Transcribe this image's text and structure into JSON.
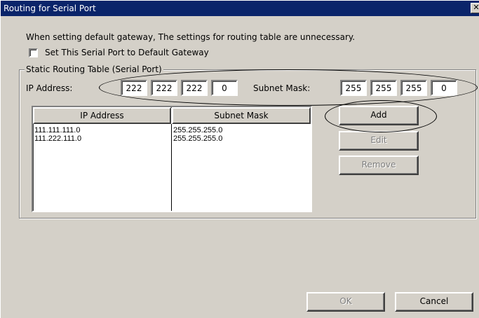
{
  "window": {
    "title": "Routing for Serial Port",
    "close_glyph": "✕"
  },
  "note": "When setting default gateway, The settings for routing table are unnecessary.",
  "default_gateway_checkbox": {
    "label": "Set This Serial Port to Default Gateway",
    "checked": false
  },
  "group": {
    "label": "Static Routing Table (Serial Port)"
  },
  "ip_label": "IP Address:",
  "ip_octets": [
    "222",
    "222",
    "222",
    "0"
  ],
  "mask_label": "Subnet Mask:",
  "mask_octets": [
    "255",
    "255",
    "255",
    "0"
  ],
  "table": {
    "columns": [
      "IP Address",
      "Subnet Mask"
    ],
    "rows": [
      {
        "ip": "111.111.111.0",
        "mask": "255.255.255.0"
      },
      {
        "ip": "111.222.111.0",
        "mask": "255.255.255.0"
      }
    ]
  },
  "buttons": {
    "add": "Add",
    "edit": "Edit",
    "remove": "Remove",
    "ok": "OK",
    "cancel": "Cancel"
  }
}
